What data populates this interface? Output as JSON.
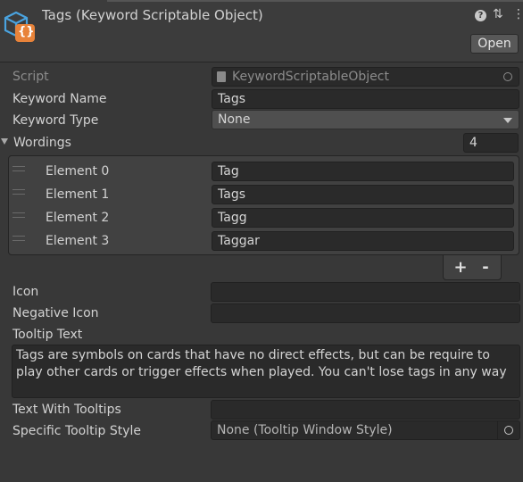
{
  "header": {
    "title": "Tags (Keyword Scriptable Object)",
    "open_label": "Open",
    "help_glyph": "?",
    "presets_glyph": "⇅",
    "more_glyph": "⋮",
    "asset_icon_glyph": "{}"
  },
  "script": {
    "label": "Script",
    "value": "KeywordScriptableObject"
  },
  "fields": {
    "keyword_name_label": "Keyword Name",
    "keyword_name_value": "Tags",
    "keyword_type_label": "Keyword Type",
    "keyword_type_value": "None",
    "wordings_label": "Wordings",
    "wordings_count": "4",
    "icon_label": "Icon",
    "icon_value": "",
    "negative_icon_label": "Negative Icon",
    "negative_icon_value": "",
    "tooltip_text_label": "Tooltip Text",
    "tooltip_text_value": "Tags are symbols on cards that have no direct effects, but can be require to play other cards or trigger effects when played. You can't lose tags in any way",
    "text_with_tooltips_label": "Text With Tooltips",
    "text_with_tooltips_value": "",
    "specific_tooltip_style_label": "Specific Tooltip Style",
    "specific_tooltip_style_value": "None (Tooltip Window Style)"
  },
  "wordings": [
    {
      "label": "Element 0",
      "value": "Tag"
    },
    {
      "label": "Element 1",
      "value": "Tags"
    },
    {
      "label": "Element 2",
      "value": "Tagg"
    },
    {
      "label": "Element 3",
      "value": "Taggar"
    }
  ],
  "list_buttons": {
    "add": "+",
    "remove": "-"
  },
  "colors": {
    "background": "#383838",
    "field": "#2a2a2a",
    "icon_blue": "#4aa3df",
    "icon_orange": "#e8833a"
  }
}
